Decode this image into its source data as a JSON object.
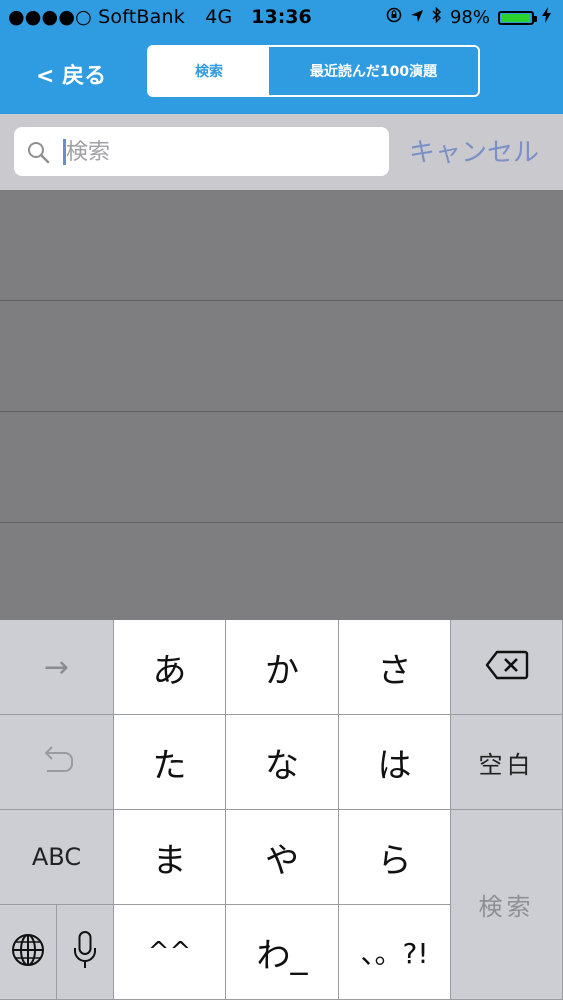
{
  "status_bar": {
    "carrier": "●●●●○ SoftBank",
    "network": "4G",
    "time": "13:36",
    "battery_percent": "98%",
    "battery_level": 0.98,
    "battery_color": "#2bd12e"
  },
  "nav": {
    "back_label": "< 戻る",
    "segments": [
      "検索",
      "最近読んだ100演題"
    ],
    "selected_segment": 0,
    "accent_color": "#2f9be0"
  },
  "search": {
    "placeholder": "検索",
    "value": "",
    "cancel_label": "キャンセル"
  },
  "keyboard": {
    "left_keys": {
      "arrow": "→",
      "abc": "ABC"
    },
    "kana": [
      [
        "あ",
        "か",
        "さ"
      ],
      [
        "た",
        "な",
        "は"
      ],
      [
        "ま",
        "や",
        "ら"
      ],
      [
        "^^",
        "わ_",
        "、。?!"
      ]
    ],
    "space_label": "空白",
    "search_label": "検索"
  }
}
